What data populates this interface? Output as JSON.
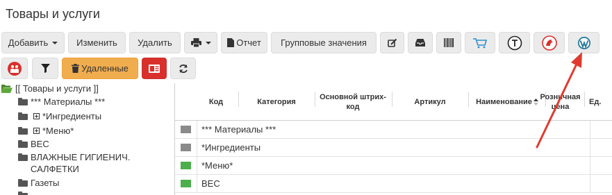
{
  "page": {
    "title": "Товары и услуги"
  },
  "toolbar": {
    "add_label": "Добавить",
    "edit_label": "Изменить",
    "delete_label": "Удалить",
    "report_label": "Отчет",
    "group_values_label": "Групповые значения",
    "deleted_label": "Удаленные"
  },
  "tree": {
    "root_label": "[[ Товары и услуги ]]",
    "items": [
      {
        "label": "*** Материалы ***"
      },
      {
        "label": "*Ингредиенты"
      },
      {
        "label": "*Меню*"
      },
      {
        "label": "ВЕС"
      },
      {
        "label": "ВЛАЖНЫЕ ГИГИЕНИЧ."
      },
      {
        "label": "САЛФЕТКИ"
      },
      {
        "label": "Газеты"
      }
    ]
  },
  "grid": {
    "columns": [
      {
        "label": "Код"
      },
      {
        "label": "Категория"
      },
      {
        "label": "Основной штрих-код"
      },
      {
        "label": "Артикул"
      },
      {
        "label": "Наименование"
      },
      {
        "label": "Розничная цена"
      },
      {
        "label": "Ед."
      }
    ],
    "rows": [
      {
        "code": "*** Материалы ***",
        "color": "#8a8a8a"
      },
      {
        "code": "*Ингредиенты",
        "color": "#8a8a8a"
      },
      {
        "code": "*Меню*",
        "color": "#4cae4c"
      },
      {
        "code": "ВЕС",
        "color": "#4cae4c"
      }
    ]
  },
  "colors": {
    "arrow": "#e03a2e",
    "deleted_button": "#f0ad4e",
    "pdf_button": "#d9302c",
    "tree_root_folder": "#4a8a2a"
  },
  "icons": [
    "caret-down-icon",
    "printer-icon",
    "document-icon",
    "edit-icon",
    "inbox-icon",
    "barcode-icon",
    "cart-icon",
    "t-circle-icon",
    "bird-icon",
    "wordpress-icon",
    "people-icon",
    "filter-icon",
    "trash-icon",
    "pdf-icon",
    "refresh-icon",
    "sort-icon",
    "folder-icon"
  ]
}
